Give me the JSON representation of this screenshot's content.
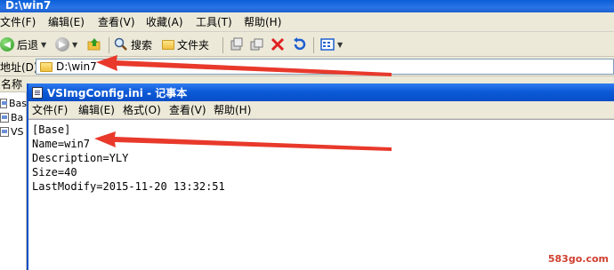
{
  "explorer": {
    "title": "D:\\win7",
    "menu": [
      "文件(F)",
      "编辑(E)",
      "查看(V)",
      "收藏(A)",
      "工具(T)",
      "帮助(H)"
    ],
    "toolbar": {
      "back_label": "后退",
      "search_label": "搜索",
      "folders_label": "文件夹"
    },
    "address": {
      "label": "地址(D)",
      "value": "D:\\win7"
    },
    "list": {
      "column_name": "名称",
      "files": [
        "Bas",
        "Ba",
        "VS"
      ]
    }
  },
  "notepad": {
    "title": "VSImgConfig.ini - 记事本",
    "menu": [
      "文件(F)",
      "编辑(E)",
      "格式(O)",
      "查看(V)",
      "帮助(H)"
    ],
    "lines": [
      "[Base]",
      "Name=win7",
      "Description=YLY",
      "Size=40",
      "LastModify=2015-11-20 13:32:51"
    ]
  },
  "watermark": "583go.com",
  "colors": {
    "arrow": "#e8392b",
    "titlebar": "#0a4fc8"
  }
}
